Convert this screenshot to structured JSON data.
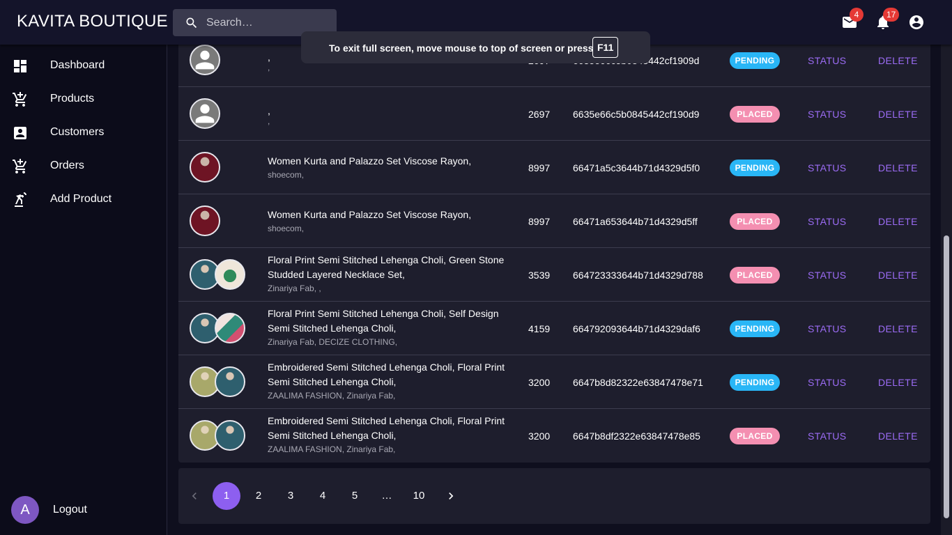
{
  "header": {
    "brand": "KAVITA BOUTIQUE",
    "search_placeholder": "Search…",
    "mail_count": "4",
    "notification_count": "17"
  },
  "sidebar": {
    "items": [
      {
        "label": "Dashboard",
        "icon": "dashboard-icon"
      },
      {
        "label": "Products",
        "icon": "cart-icon"
      },
      {
        "label": "Customers",
        "icon": "account-box-icon"
      },
      {
        "label": "Orders",
        "icon": "cart-icon"
      },
      {
        "label": "Add Product",
        "icon": "add-product-icon"
      }
    ],
    "logout": {
      "avatar_letter": "A",
      "label": "Logout"
    }
  },
  "fullscreen_notice": {
    "text": "To exit full screen, move mouse to top of screen or press",
    "key": "F11"
  },
  "orders": {
    "status_action": "STATUS",
    "delete_action": "DELETE",
    "rows": [
      {
        "thumbs": [
          "person"
        ],
        "title": ",",
        "brands": ",",
        "price": "2697",
        "order_id": "6635e66c5b0845442cf1909d",
        "status": "PENDING"
      },
      {
        "thumbs": [
          "person"
        ],
        "title": ",",
        "brands": ",",
        "price": "2697",
        "order_id": "6635e66c5b0845442cf190d9",
        "status": "PLACED"
      },
      {
        "thumbs": [
          "maroon-kurta"
        ],
        "title": "Women Kurta and Palazzo Set Viscose Rayon,",
        "brands": "shoecom,",
        "price": "8997",
        "order_id": "66471a5c3644b71d4329d5f0",
        "status": "PENDING"
      },
      {
        "thumbs": [
          "maroon-kurta"
        ],
        "title": "Women Kurta and Palazzo Set Viscose Rayon,",
        "brands": "shoecom,",
        "price": "8997",
        "order_id": "66471a653644b71d4329d5ff",
        "status": "PLACED"
      },
      {
        "thumbs": [
          "teal-lehenga",
          "green-necklace"
        ],
        "title": "Floral Print Semi Stitched Lehenga Choli, Green Stone Studded Layered Necklace Set,",
        "brands": "Zinariya Fab, ,",
        "price": "3539",
        "order_id": "664723333644b71d4329d788",
        "status": "PLACED"
      },
      {
        "thumbs": [
          "teal-lehenga",
          "pink-green-lehenga"
        ],
        "title": "Floral Print Semi Stitched Lehenga Choli, Self Design Semi Stitched Lehenga Choli,",
        "brands": "Zinariya Fab, DECIZE CLOTHING,",
        "price": "4159",
        "order_id": "664792093644b71d4329daf6",
        "status": "PENDING"
      },
      {
        "thumbs": [
          "olive-lehenga",
          "teal-lehenga"
        ],
        "title": "Embroidered Semi Stitched Lehenga Choli, Floral Print Semi Stitched Lehenga Choli,",
        "brands": "ZAALIMA FASHION, Zinariya Fab,",
        "price": "3200",
        "order_id": "6647b8d82322e63847478e71",
        "status": "PENDING"
      },
      {
        "thumbs": [
          "olive-lehenga",
          "teal-lehenga"
        ],
        "title": "Embroidered Semi Stitched Lehenga Choli, Floral Print Semi Stitched Lehenga Choli,",
        "brands": "ZAALIMA FASHION, Zinariya Fab,",
        "price": "3200",
        "order_id": "6647b8df2322e63847478e85",
        "status": "PLACED"
      }
    ]
  },
  "pagination": {
    "pages": [
      "1",
      "2",
      "3",
      "4",
      "5",
      "…",
      "10"
    ],
    "current": "1"
  },
  "colors": {
    "accent": "#8d5ff0",
    "pending": "#29b6f6",
    "placed": "#f48fb1",
    "badge": "#e53935"
  }
}
